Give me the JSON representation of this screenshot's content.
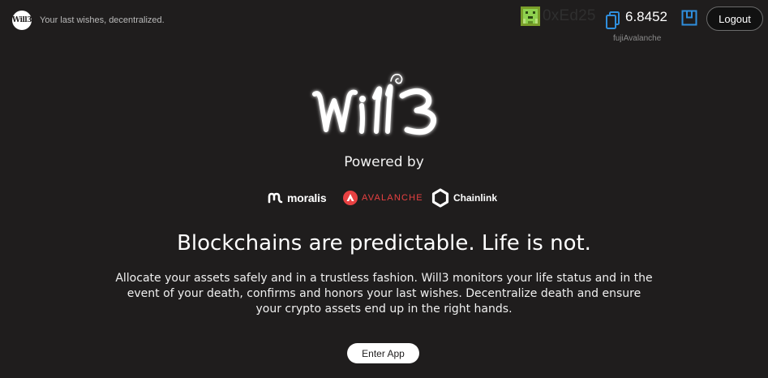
{
  "header": {
    "brand_logo_text": "Will3",
    "tagline": "Your last wishes, decentralized.",
    "account": {
      "address": "0xEd25",
      "balance": "6.8452",
      "network": "fujiAvalanche"
    },
    "logout_label": "Logout"
  },
  "hero": {
    "logo_text": "Will3",
    "powered_by": "Powered by",
    "partners": [
      {
        "name": "moralis",
        "icon": "moralis-logo-icon"
      },
      {
        "name": "AVALANCHE",
        "icon": "avalanche-logo-icon"
      },
      {
        "name": "Chainlink",
        "icon": "chainlink-logo-icon"
      }
    ],
    "headline": "Blockchains are predictable. Life is not.",
    "description": "Allocate your assets safely and in a trustless fashion. Will3 monitors your life status and in the event of your death, confirms and honors your last wishes. Decentralize death and ensure your crypto assets end up in the right hands.",
    "cta_label": "Enter App"
  },
  "colors": {
    "background": "#1f1d1d",
    "avalanche_red": "#e84142",
    "wallet_blue": "#2f8fde",
    "identicon_green": "#8fd14f"
  }
}
